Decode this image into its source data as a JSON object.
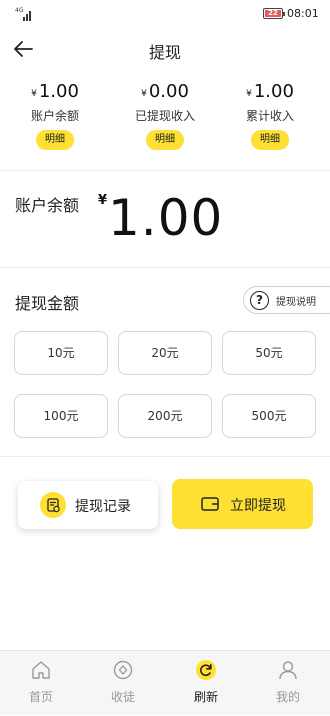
{
  "colors": {
    "accent": "#FFE033",
    "text": "#222222",
    "muted": "#999999",
    "battery": "#e85a5a"
  },
  "status_bar": {
    "network": "4G",
    "battery": "22",
    "time": "08:01"
  },
  "header": {
    "title": "提现",
    "back_icon": "arrow-left-icon"
  },
  "currency": "¥",
  "stats": [
    {
      "value": "1.00",
      "label": "账户余额",
      "detail": "明细"
    },
    {
      "value": "0.00",
      "label": "已提现收入",
      "detail": "明细"
    },
    {
      "value": "1.00",
      "label": "累计收入",
      "detail": "明细"
    }
  ],
  "balance": {
    "label": "账户余额",
    "amount": "1.00"
  },
  "withdraw": {
    "label": "提现金额",
    "explain": "提现说明",
    "options": [
      "10元",
      "20元",
      "50元",
      "100元",
      "200元",
      "500元"
    ]
  },
  "actions": {
    "record": "提现记录",
    "withdraw_now": "立即提现"
  },
  "tabs": [
    {
      "label": "首页",
      "icon": "home-icon",
      "active": false
    },
    {
      "label": "收徒",
      "icon": "apprentice-icon",
      "active": false
    },
    {
      "label": "刷新",
      "icon": "refresh-icon",
      "active": true
    },
    {
      "label": "我的",
      "icon": "user-icon",
      "active": false
    }
  ]
}
